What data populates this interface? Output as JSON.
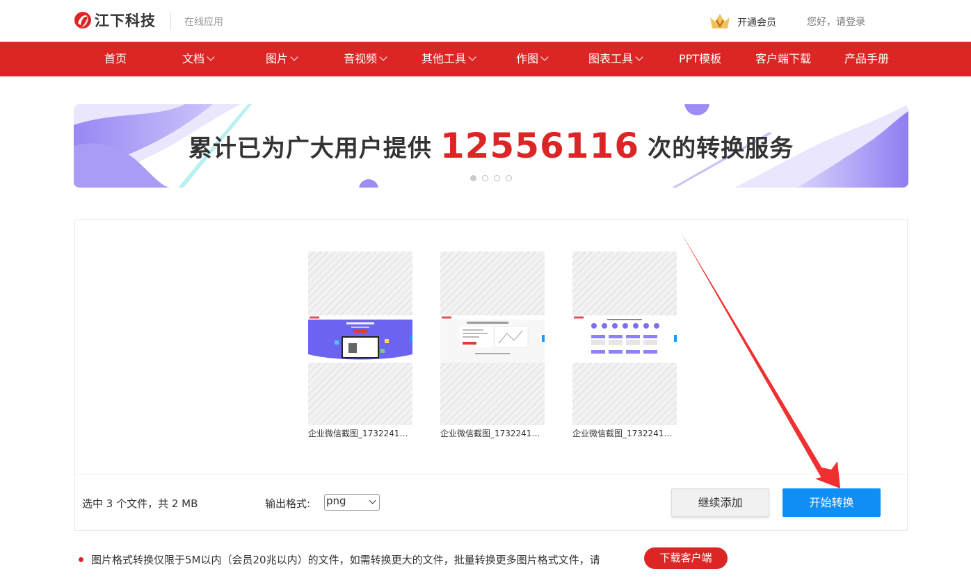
{
  "header": {
    "logo_text": "江下科技",
    "logo_sub": "在线应用",
    "vip_label": "开通会员",
    "login_label": "您好，请登录"
  },
  "nav": {
    "items": [
      {
        "label": "首页",
        "dropdown": false
      },
      {
        "label": "文档",
        "dropdown": true
      },
      {
        "label": "图片",
        "dropdown": true
      },
      {
        "label": "音视频",
        "dropdown": true
      },
      {
        "label": "其他工具",
        "dropdown": true
      },
      {
        "label": "作图",
        "dropdown": true
      },
      {
        "label": "图表工具",
        "dropdown": true
      },
      {
        "label": "PPT模板",
        "dropdown": false
      },
      {
        "label": "客户端下载",
        "dropdown": false
      },
      {
        "label": "产品手册",
        "dropdown": false
      }
    ]
  },
  "banner": {
    "prefix": "累计已为广大用户提供",
    "count": "12556116",
    "suffix": "次的转换服务",
    "slides": 4,
    "active_slide": 0
  },
  "files": [
    {
      "name": "企业微信截图_17322410...",
      "preview_theme": "purple-landing"
    },
    {
      "name": "企业微信截图_17322412...",
      "preview_theme": "document-editor"
    },
    {
      "name": "企业微信截图_17322410...",
      "preview_theme": "tool-grid"
    }
  ],
  "panel": {
    "summary": "选中 3 个文件，共 2 MB",
    "format_label": "输出格式:",
    "format_value": "png",
    "add_button": "继续添加",
    "start_button": "开始转换"
  },
  "notice": {
    "text": "图片格式转换仅限于5M以内（会员20兆以内）的文件，如需转换更大的文件，批量转换更多图片格式文件，请",
    "download_button": "下载客户端"
  },
  "colors": {
    "brand_red": "#dc2626",
    "primary_blue": "#0f8ef6",
    "annotation_arrow": "#f03030"
  }
}
